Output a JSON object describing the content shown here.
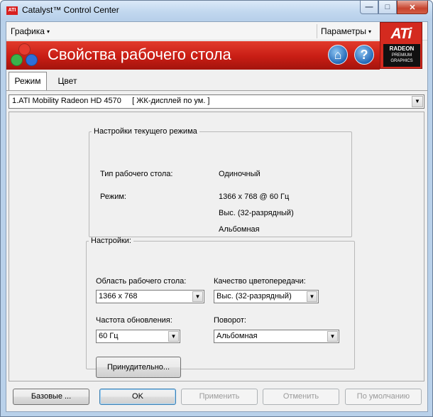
{
  "window": {
    "icon_text": "ATI",
    "title": "Catalyst™ Control Center",
    "controls": {
      "minimize": "—",
      "maximize": "□",
      "close": "✕"
    }
  },
  "menu": {
    "graphics": "Графика",
    "parameters": "Параметры",
    "arrow": "▾"
  },
  "logo": {
    "brand": "ATi",
    "line1": "RADEON",
    "line2": "PREMIUM",
    "line3": "GRAPHICS"
  },
  "banner": {
    "title": "Свойства рабочего стола",
    "home_icon": "⌂",
    "help_icon": "?"
  },
  "tabs": [
    {
      "label": "Режим",
      "active": true
    },
    {
      "label": "Цвет",
      "active": false
    }
  ],
  "display_select": {
    "value": "1.ATI Mobility Radeon HD 4570     [ ЖК-дисплей по ум. ]",
    "arrow": "▼"
  },
  "current_mode": {
    "legend": "Настройки текущего режима",
    "desktop_type_label": "Тип рабочего стола:",
    "desktop_type_value": "Одиночный",
    "mode_label": "Режим:",
    "mode_resolution": "1366 x 768 @ 60 Гц",
    "mode_depth": "Выс. (32-разрядный)",
    "mode_orientation": "Альбомная"
  },
  "settings": {
    "legend": "Настройки:",
    "desktop_area_label": "Область рабочего стола:",
    "desktop_area_value": "1366 x 768",
    "color_quality_label": "Качество цветопередачи:",
    "color_quality_value": "Выс. (32-разрядный)",
    "refresh_label": "Частота обновления:",
    "refresh_value": "60 Гц",
    "rotation_label": "Поворот:",
    "rotation_value": "Альбомная",
    "force_button": "Принудительно..."
  },
  "buttons": {
    "basic": "Базовые ...",
    "ok": "OK",
    "apply": "Применить",
    "cancel": "Отменить",
    "defaults": "По умолчанию"
  },
  "colors": {
    "banner_red": "#c81d14",
    "ati_red": "#d42a1f",
    "ball_red": "#e53b2f",
    "ball_green": "#3bb34a",
    "ball_blue": "#2f6fd8"
  }
}
